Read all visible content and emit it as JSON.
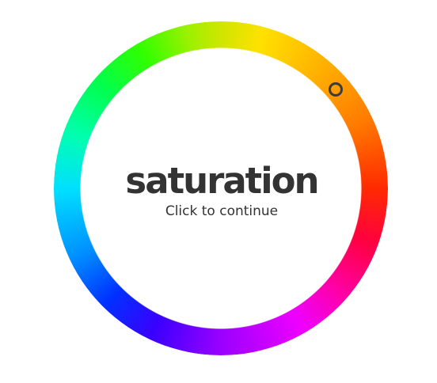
{
  "wheel": {
    "mode_title": "saturation",
    "instruction": "Click to continue",
    "handle_color": "#3b3b3b",
    "text_color": "#333333"
  }
}
